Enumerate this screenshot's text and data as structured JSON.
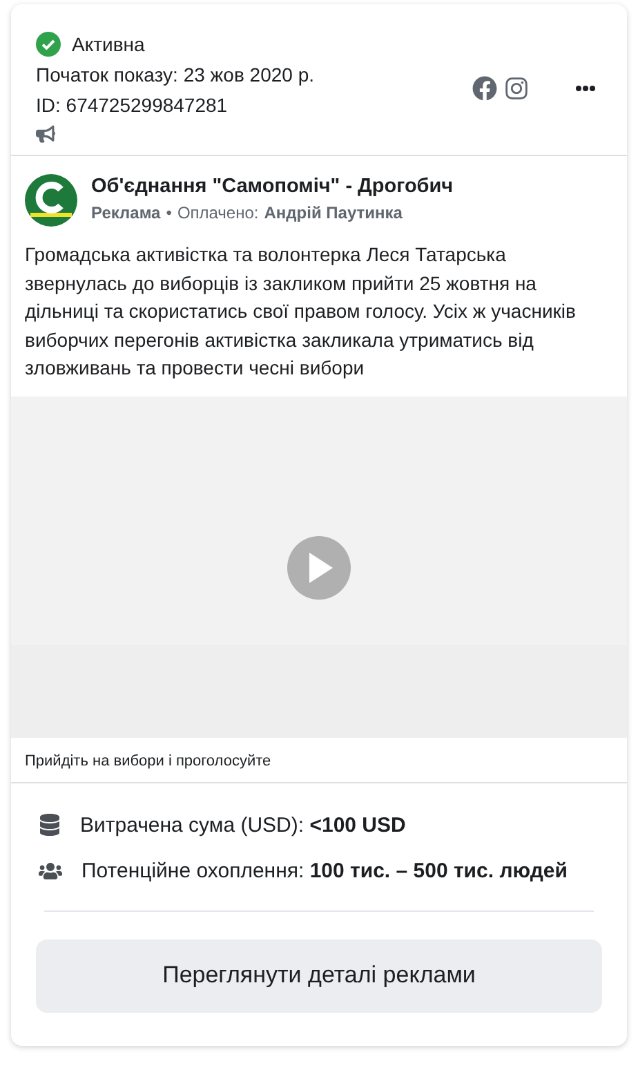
{
  "status": {
    "label": "Активна",
    "active": true
  },
  "start_date": "Початок показу: 23 жов 2020 р.",
  "ad_id": "ID: 674725299847281",
  "post": {
    "page_name": "Об'єднання \"Самопоміч\" - Дрогобич",
    "sponsored": "Реклама",
    "separator": "•",
    "paid_by_label": "Оплачено:",
    "paid_by": "Андрій Паутинка",
    "text": "Громадська активістка та волонтерка Леся Татарська звернулась до виборців із закликом прийти 25 жовтня на дільниці та скористатись свої правом голосу. Усіх ж учасників виборчих перегонів активістка закликала утриматись від зловживань та провести чесні вибори",
    "caption": "Прийдіть на вибори і проголосуйте"
  },
  "stats": [
    {
      "kind": "money",
      "text": "Витрачена сума (USD): **<100 USD**"
    },
    {
      "kind": "people",
      "text": "Потенційне охоплення: **100 тис. – 500 тис. людей**"
    }
  ],
  "details_button": "Переглянути деталі реклами"
}
